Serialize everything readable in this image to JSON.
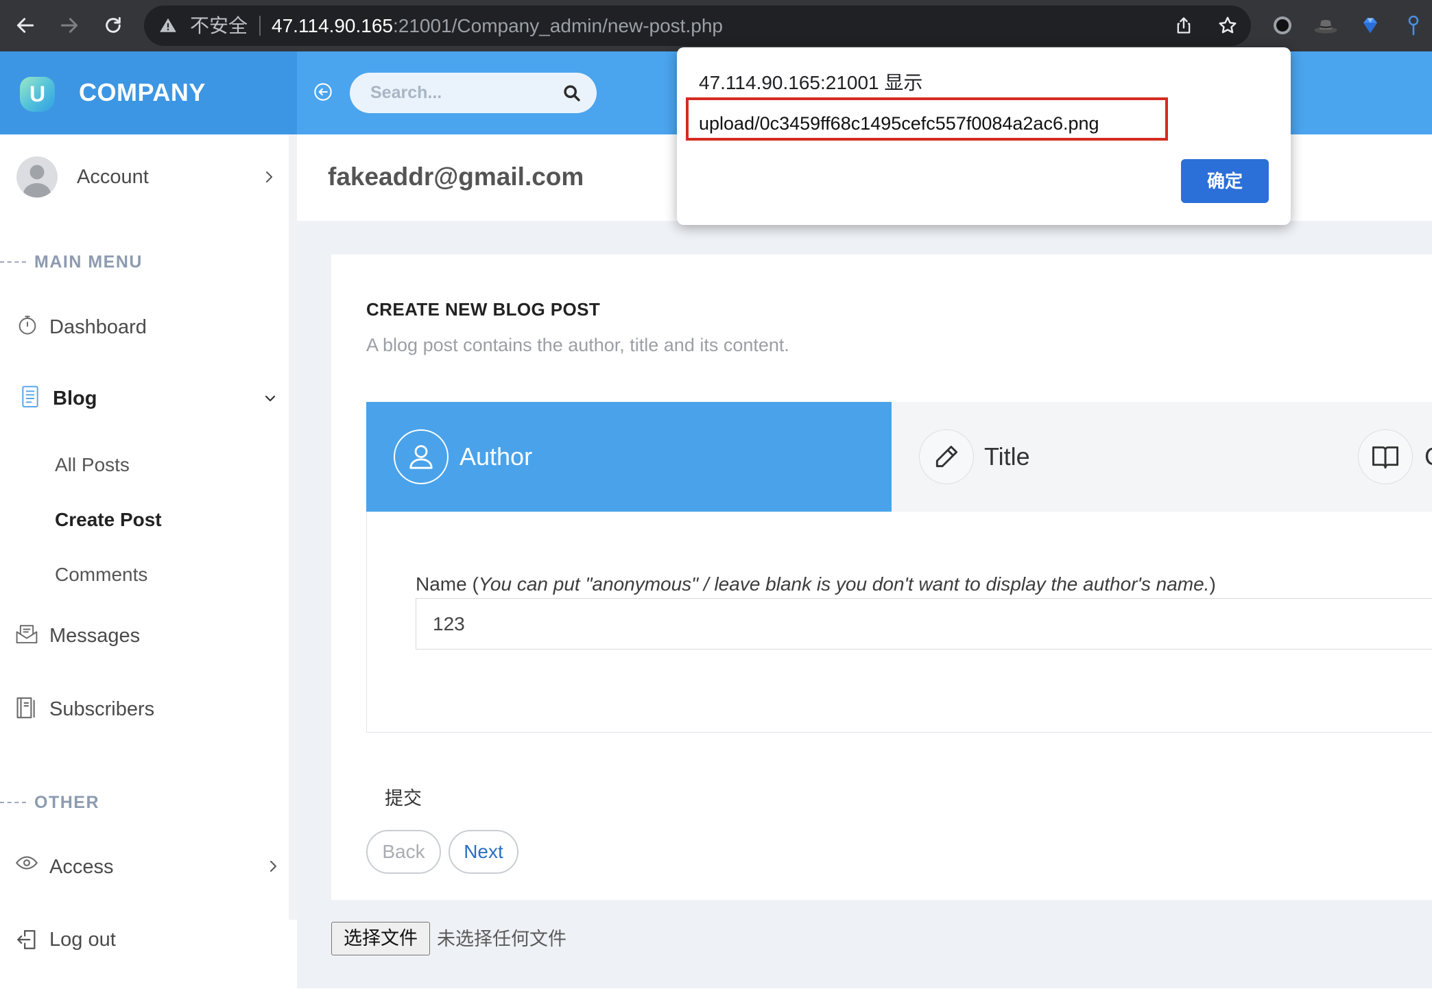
{
  "browser": {
    "security_label": "不安全",
    "url_host": "47.114.90.165",
    "url_path": ":21001/Company_admin/new-post.php",
    "nav_icons": [
      "back-arrow-icon",
      "forward-arrow-icon",
      "reload-icon"
    ],
    "omnibox_icons": [
      "warning-icon",
      "share-icon",
      "bookmark-star-icon"
    ],
    "extension_icons": [
      "record-extension-icon",
      "hat-extension-icon",
      "diamond-extension-icon",
      "pin-extension-icon"
    ]
  },
  "header": {
    "logo_letter": "U",
    "brand": "COMPANY",
    "search_placeholder": "Search...",
    "icons": [
      "collapse-sidebar-icon",
      "search-icon"
    ]
  },
  "sidebar": {
    "account_label": "Account",
    "main_menu_heading": "MAIN MENU",
    "items": [
      {
        "label": "Dashboard",
        "icon": "stopwatch-icon"
      },
      {
        "label": "Blog",
        "icon": "document-icon",
        "expanded": true
      },
      {
        "label": "Messages",
        "icon": "envelope-icon"
      },
      {
        "label": "Subscribers",
        "icon": "notebook-icon"
      }
    ],
    "blog_submenu": [
      {
        "label": "All Posts",
        "active": false
      },
      {
        "label": "Create Post",
        "active": true
      },
      {
        "label": "Comments",
        "active": false
      }
    ],
    "other_heading": "OTHER",
    "other_items": [
      {
        "label": "Access",
        "icon": "eye-icon"
      },
      {
        "label": "Log out",
        "icon": "logout-icon"
      }
    ]
  },
  "topbar": {
    "user_email": "fakeaddr@gmail.com"
  },
  "card": {
    "title": "CREATE NEW BLOG POST",
    "subtitle": "A blog post contains the author, title and its content.",
    "tabs": [
      {
        "label": "Author",
        "icon": "user-icon",
        "active": true
      },
      {
        "label": "Title",
        "icon": "pencil-icon",
        "active": false
      },
      {
        "label": "C",
        "icon": "book-icon",
        "active": false
      }
    ],
    "form": {
      "name_label": "Name (",
      "name_hint": "You can put \"anonymous\" / leave blank is you don't want to display the author's name.",
      "name_label_close": ")",
      "name_value": "123"
    },
    "submit_label": "提交",
    "back_label": "Back",
    "next_label": "Next"
  },
  "file_input": {
    "button_label": "选择文件",
    "status": "未选择任何文件"
  },
  "dialog": {
    "title": "47.114.90.165:21001 显示",
    "message": "upload/0c3459ff68c1495cefc557f0084a2ac6.png",
    "ok_label": "确定"
  },
  "colors": {
    "header_brand_bg": "#3d96e3",
    "header_bar_bg": "#4aa4ee",
    "active_tab_bg": "#4aa3ea",
    "dialog_button": "#2b6fd9",
    "highlight_box": "#d42b20",
    "next_link": "#2a6fc4"
  }
}
